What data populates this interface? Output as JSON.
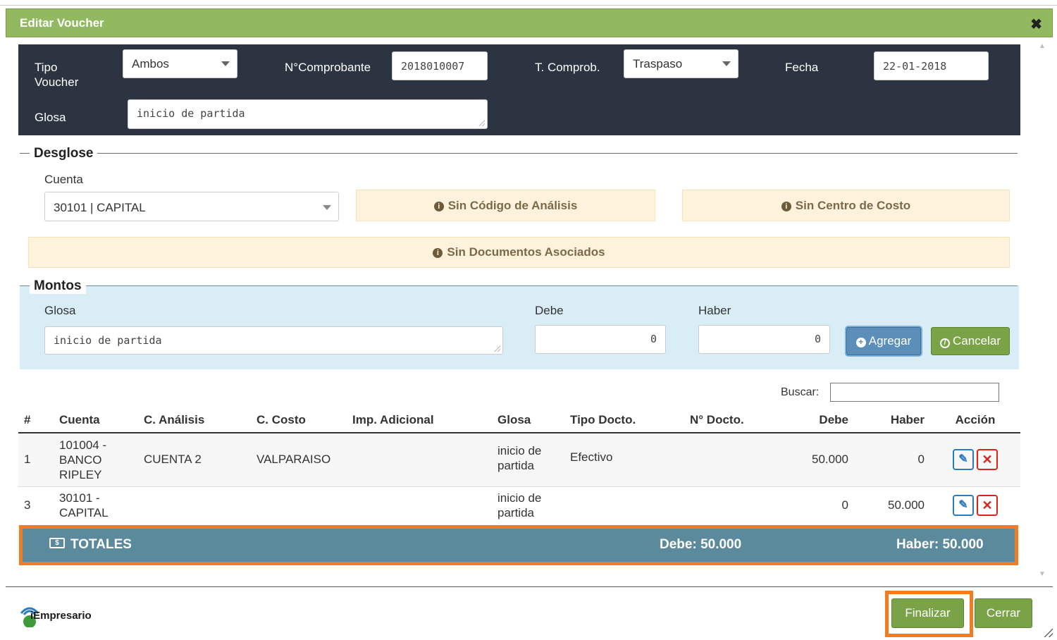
{
  "dialog": {
    "title": "Editar Voucher",
    "close_symbol": "✖"
  },
  "header_form": {
    "tipo_voucher_label": "Tipo\nVoucher",
    "tipo_voucher_value": "Ambos",
    "comprobante_label": "N°Comprobante",
    "comprobante_value": "2018010007",
    "t_comprob_label": "T. Comprob.",
    "t_comprob_value": "Traspaso",
    "fecha_label": "Fecha",
    "fecha_value": "22-01-2018",
    "glosa_label": "Glosa",
    "glosa_value": "inicio de partida"
  },
  "desglose": {
    "legend": "Desglose",
    "cuenta_label": "Cuenta",
    "cuenta_value": "30101 | CAPITAL",
    "sin_codigo": "Sin Código de Análisis",
    "sin_centro": "Sin Centro de Costo",
    "sin_documentos": "Sin Documentos Asociados"
  },
  "montos": {
    "legend": "Montos",
    "glosa_label": "Glosa",
    "glosa_value": "inicio de partida",
    "debe_label": "Debe",
    "debe_value": "0",
    "haber_label": "Haber",
    "haber_value": "0",
    "agregar_label": "Agregar",
    "cancelar_label": "Cancelar"
  },
  "table": {
    "search_label": "Buscar:",
    "headers": [
      "#",
      "Cuenta",
      "C. Análisis",
      "C. Costo",
      "Imp. Adicional",
      "Glosa",
      "Tipo Docto.",
      "N° Docto.",
      "Debe",
      "Haber",
      "Acción"
    ],
    "rows": [
      {
        "num": "1",
        "cuenta": "101004 -\nBANCO\nRIPLEY",
        "c_analisis": "CUENTA 2",
        "c_costo": "VALPARAISO",
        "imp_adicional": "",
        "glosa": "inicio de\npartida",
        "tipo_docto": "Efectivo",
        "n_docto": "",
        "debe": "50.000",
        "haber": "0"
      },
      {
        "num": "3",
        "cuenta": "30101 -\nCAPITAL",
        "c_analisis": "",
        "c_costo": "",
        "imp_adicional": "",
        "glosa": "inicio de\npartida",
        "tipo_docto": "",
        "n_docto": "",
        "debe": "0",
        "haber": "50.000"
      }
    ]
  },
  "totales": {
    "label": "TOTALES",
    "debe": "Debe: 50.000",
    "haber": "Haber: 50.000"
  },
  "footer": {
    "finalizar_label": "Finalizar",
    "cerrar_label": "Cerrar",
    "logo_text": "iEmpresario"
  },
  "colors": {
    "title_green": "#92b860",
    "dark_panel": "#2b3440",
    "totales_bg": "#5a8a9c",
    "highlight_orange": "#f47c20",
    "button_green": "#7aa246",
    "info_blue": "#d9edf7"
  }
}
